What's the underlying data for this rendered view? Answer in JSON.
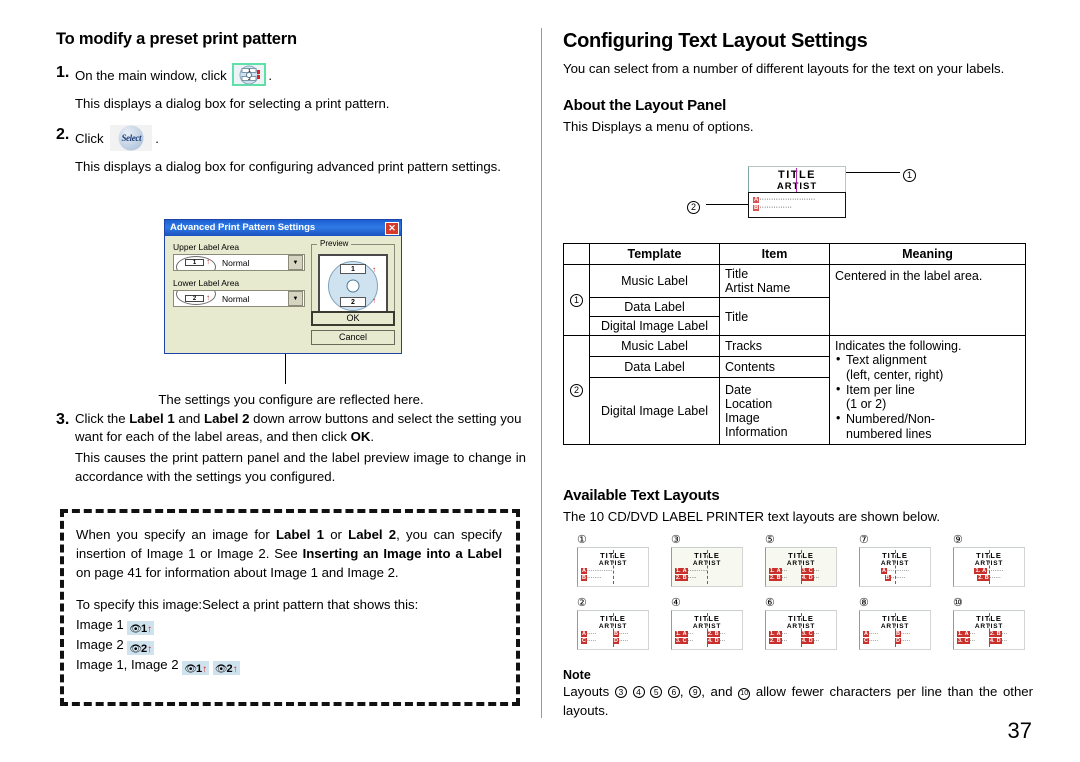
{
  "left": {
    "heading": "To modify a preset print pattern",
    "steps": [
      {
        "num": "1.",
        "text_before": "On the main window, click",
        "text_after": "."
      },
      {
        "num": "2.",
        "text_before": "Click",
        "text_after": "."
      },
      {
        "num": "3.",
        "text": "Click the Label 1 and Label 2 down arrow buttons and select the setting you want for each of the label areas, and then click OK."
      }
    ],
    "step1_result": "This displays a dialog box for selecting a print pattern.",
    "step2_result": "This displays a dialog box for configuring advanced print pattern settings.",
    "step3_result": "This causes the print pattern panel and the label preview image to change in accordance with the settings you configured.",
    "dialog_caption": "The settings you configure are reflected here.",
    "cd_button_icon": "cd-label-pattern-icon",
    "select_button_label": "Select",
    "dialog": {
      "title": "Advanced Print Pattern Settings",
      "close_icon": "close-icon",
      "upper_label_area_label": "Upper Label Area",
      "upper_value": "Normal",
      "upper_icon_num": "1",
      "lower_label_area_label": "Lower Label Area",
      "lower_value": "Normal",
      "lower_icon_num": "2",
      "preview_legend": "Preview",
      "preview_top_num": "1",
      "preview_bottom_num": "2",
      "ok_label": "OK",
      "cancel_label": "Cancel"
    },
    "note_box": {
      "p1": "When you specify an image for Label 1 or Label 2, you can specify insertion of Image 1 or Image 2. See Inserting an Image into a Label on page 41 for information about Image 1 and Image 2.",
      "p2": "To specify this image:Select a print pattern that shows this:",
      "rows": [
        {
          "label": "Image 1",
          "chips": [
            "1"
          ]
        },
        {
          "label": "Image 2",
          "chips": [
            "2"
          ]
        },
        {
          "label": "Image 1, Image 2",
          "chips": [
            "1",
            "2"
          ]
        }
      ],
      "chip_icon": "image-eye-icon",
      "chip_arrow": "up-arrow-icon"
    }
  },
  "right": {
    "title": "Configuring Text Layout Settings",
    "intro": "You can select from a number of different layouts for the text on your labels.",
    "about_heading": "About the Layout Panel",
    "about_text": "This Displays a menu of options.",
    "panel_illustration": {
      "title": "TITLE",
      "artist": "ARTIST",
      "line_a_tag": "A",
      "line_b_tag": "B",
      "callout_1": "①",
      "callout_2": "②"
    },
    "table": {
      "headers": [
        "",
        "Template",
        "Item",
        "Meaning"
      ],
      "group1_num": "①",
      "group2_num": "②",
      "rows_group1": [
        {
          "template": "Music Label",
          "item": "Title\nArtist Name"
        },
        {
          "template": "Data Label",
          "item": "Title"
        },
        {
          "template": "Digital Image Label",
          "item": ""
        }
      ],
      "group1_meaning": "Centered in the label area.",
      "rows_group2": [
        {
          "template": "Music Label",
          "item": "Tracks"
        },
        {
          "template": "Data Label",
          "item": "Contents"
        },
        {
          "template": "Digital Image Label",
          "item": "Date\nLocation\nImage\nInformation"
        }
      ],
      "group2_meaning_intro": "Indicates the following.",
      "group2_bullets": [
        "Text alignment",
        "(left, center, right)",
        "Item per line",
        "(1 or 2)",
        "Numbered/Non-",
        "numbered lines"
      ]
    },
    "layouts_heading": "Available Text Layouts",
    "layouts_intro": "The 10 CD/DVD LABEL PRINTER text layouts are shown below.",
    "layouts": [
      {
        "num": "①",
        "title": "TITLE",
        "artist": "ARTIST",
        "lines": [
          [
            "A··············"
          ],
          [
            "B········"
          ]
        ],
        "columns": 1,
        "numbered": false,
        "guide": "purple"
      },
      {
        "num": "②",
        "title": "TITLE",
        "artist": "ARTIST",
        "lines": [
          [
            "A·····",
            "B·····"
          ],
          [
            "C·····",
            "D·····"
          ]
        ],
        "columns": 2,
        "numbered": false,
        "guide": "red"
      },
      {
        "num": "③",
        "title": "TITLE",
        "artist": "ARTIST",
        "lines": [
          [
            "1.A···········"
          ],
          [
            "2.B·····"
          ]
        ],
        "columns": 1,
        "numbered": true,
        "guide": "red"
      },
      {
        "num": "④",
        "title": "TITLE",
        "artist": "ARTIST",
        "lines": [
          [
            "1.A···",
            "2.B···"
          ],
          [
            "3.C···",
            "4.D···"
          ]
        ],
        "columns": 2,
        "numbered": true,
        "guide": "red"
      },
      {
        "num": "⑤",
        "title": "TITLE",
        "artist": "ARTIST",
        "lines": [
          [
            "1.A···",
            "3.C···"
          ],
          [
            "2.B···",
            "4.D···"
          ]
        ],
        "columns": 2,
        "numbered": true,
        "guide": "red"
      },
      {
        "num": "⑥",
        "title": "TITLE",
        "artist": "ARTIST",
        "lines": [
          [
            "1.A···",
            "3.C···"
          ],
          [
            "2.B···",
            "4.D···"
          ]
        ],
        "columns": 2,
        "numbered": true,
        "guide": "red"
      },
      {
        "num": "⑦",
        "title": "TITLE",
        "artist": "ARTIST",
        "lines": [
          [
            "A············"
          ],
          [
            "B········"
          ]
        ],
        "columns": 1,
        "numbered": false,
        "guide": "red",
        "centered": true
      },
      {
        "num": "⑧",
        "title": "TITLE",
        "artist": "ARTIST",
        "lines": [
          [
            "A·····",
            "B·····"
          ],
          [
            "C·····",
            "D·····"
          ]
        ],
        "columns": 2,
        "numbered": false,
        "guide": "red"
      },
      {
        "num": "⑨",
        "title": "TITLE",
        "artist": "ARTIST",
        "lines": [
          [
            "1.A·········"
          ],
          [
            "2.B······"
          ]
        ],
        "columns": 1,
        "numbered": true,
        "guide": "red",
        "centered": true
      },
      {
        "num": "⑩",
        "title": "TITLE",
        "artist": "ARTIST",
        "lines": [
          [
            "1.A···",
            "2.B···"
          ],
          [
            "3.C···",
            "4.D···"
          ]
        ],
        "columns": 2,
        "numbered": true,
        "guide": "red"
      }
    ],
    "note_heading": "Note",
    "note_text": "Layouts ③ ④ ⑤ ⑥, ⑨, and ⑩ allow fewer characters per line than the other layouts.",
    "page_number": "37"
  }
}
